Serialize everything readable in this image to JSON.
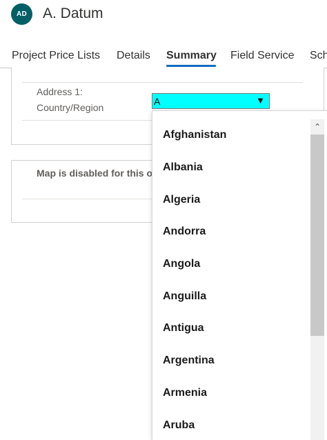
{
  "header": {
    "avatar_initials": "AD",
    "title": "A. Datum",
    "avatar_color": "#035f66"
  },
  "tabs": [
    {
      "label": "Project Price Lists",
      "selected": false
    },
    {
      "label": "Details",
      "selected": false
    },
    {
      "label": "Summary",
      "selected": true
    },
    {
      "label": "Field Service",
      "selected": false
    },
    {
      "label": "Sch",
      "selected": false
    }
  ],
  "address": {
    "label_line1": "Address 1:",
    "label_line2": "Country/Region",
    "select_value": "A",
    "select_highlight_color": "#00ffff"
  },
  "map": {
    "message": "Map is disabled for this o"
  },
  "dropdown": {
    "options": [
      "Afghanistan",
      "Albania",
      "Algeria",
      "Andorra",
      "Angola",
      "Anguilla",
      "Antigua",
      "Argentina",
      "Armenia",
      "Aruba"
    ]
  },
  "colors": {
    "accent": "#0f6cbd"
  }
}
